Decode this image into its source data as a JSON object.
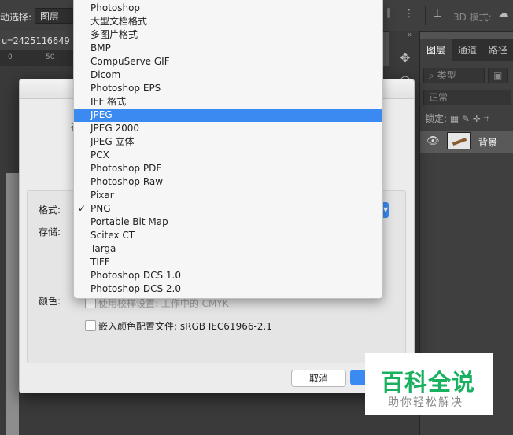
{
  "options_bar": {
    "auto_select_label": "动选择:",
    "auto_select_value": "图层",
    "mode_3d_label": "3D 模式:"
  },
  "document": {
    "tab_title": "u=2425116649",
    "ruler_ticks": [
      "0",
      "50"
    ]
  },
  "panels": {
    "tabs": [
      "图层",
      "通道",
      "路径"
    ],
    "active_tab": "图层",
    "filter_kind": "类型",
    "blend_mode": "正常",
    "lock_label": "锁定:",
    "layers": [
      {
        "name": "背景"
      }
    ]
  },
  "save_dialog": {
    "partial_label": "存",
    "format_label": "格式:",
    "storage_label": "存储:",
    "color_label": "颜色:",
    "checkbox_proof": "使用校样设置: 工作中的 CMYK",
    "checkbox_embed": "嵌入颜色配置文件: sRGB IEC61966-2.1",
    "cancel_label": "取消"
  },
  "format_dropdown": {
    "items": [
      "Photoshop",
      "大型文档格式",
      "多图片格式",
      "BMP",
      "CompuServe GIF",
      "Dicom",
      "Photoshop EPS",
      "IFF 格式",
      "JPEG",
      "JPEG 2000",
      "JPEG 立体",
      "PCX",
      "Photoshop PDF",
      "Photoshop Raw",
      "Pixar",
      "PNG",
      "Portable Bit Map",
      "Scitex CT",
      "Targa",
      "TIFF",
      "Photoshop DCS 1.0",
      "Photoshop DCS 2.0"
    ],
    "highlighted": "JPEG",
    "checked": "PNG",
    "check_glyph": "✓",
    "highlight_color": "#3b8af2"
  },
  "watermark": {
    "title": "百科全说",
    "subtitle": "助你轻松解决"
  }
}
